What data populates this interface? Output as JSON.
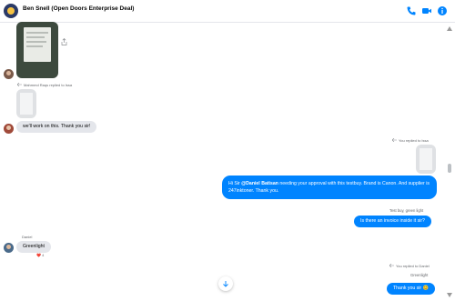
{
  "header": {
    "title": "Ben Snell (Open Doors Enterprise Deal)",
    "icons": [
      "phone-icon",
      "video-icon",
      "info-icon"
    ],
    "accent": "#0084ff"
  },
  "messages": {
    "reply1_note": "Mahmmd Raqs replied to Issa",
    "msg1": "we'll work on this. Thank you sir!",
    "reply2_note": "You replied to Issa",
    "msg2_pre": "Hi Sir ",
    "msg2_mention": "@Daniel Batisan",
    "msg2_post": " needing your approval with this testbuy. Brand is Canon. And supplier is 247inktoner. Thank you.",
    "quoted1": "Test buy, green light",
    "msg3": "Is there an invoice inside it sir?",
    "sender_daniel": "Daniel",
    "msg4": "Greenlight",
    "reaction": "❤️ 4",
    "reply3_note": "You replied to Daniel",
    "quoted2": "Greenlight",
    "msg5": "Thank you sir 😊"
  }
}
